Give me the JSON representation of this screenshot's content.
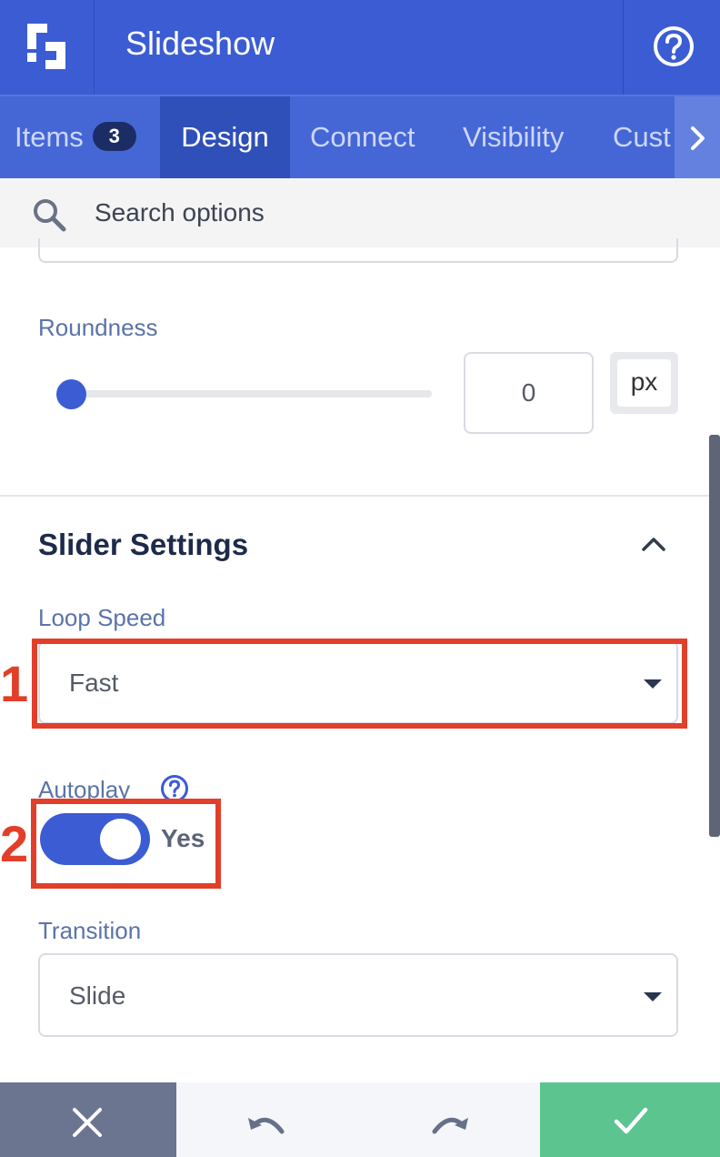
{
  "header": {
    "title": "Slideshow",
    "logo_icon": "logo-icon",
    "help_icon": "help-circle-icon"
  },
  "tabs": [
    {
      "label": "Items",
      "badge": "3",
      "active": false
    },
    {
      "label": "Design",
      "active": true
    },
    {
      "label": "Connect",
      "active": false
    },
    {
      "label": "Visibility",
      "active": false
    },
    {
      "label": "Cust",
      "active": false
    }
  ],
  "tabs_next_icon": "chevron-right-icon",
  "search": {
    "placeholder": "Search options",
    "icon": "search-icon"
  },
  "roundness": {
    "label": "Roundness",
    "value": "0",
    "slider_fraction": 0,
    "unit": "px"
  },
  "slider_settings": {
    "title": "Slider Settings",
    "collapse_icon": "chevron-up-icon",
    "loop_speed": {
      "label": "Loop Speed",
      "value": "Fast"
    },
    "autoplay": {
      "label": "Autoplay",
      "help_icon": "help-circle-icon",
      "on": true,
      "state_text": "Yes"
    },
    "transition": {
      "label": "Transition",
      "value": "Slide"
    }
  },
  "annotations": [
    "1",
    "2"
  ],
  "footer": {
    "cancel_icon": "close-icon",
    "undo_icon": "undo-icon",
    "redo_icon": "redo-icon",
    "save_icon": "check-icon"
  },
  "colors": {
    "primary": "#3b5cd3",
    "annotation": "#e23f2a",
    "save": "#5cc48f",
    "cancel": "#6b7590"
  }
}
